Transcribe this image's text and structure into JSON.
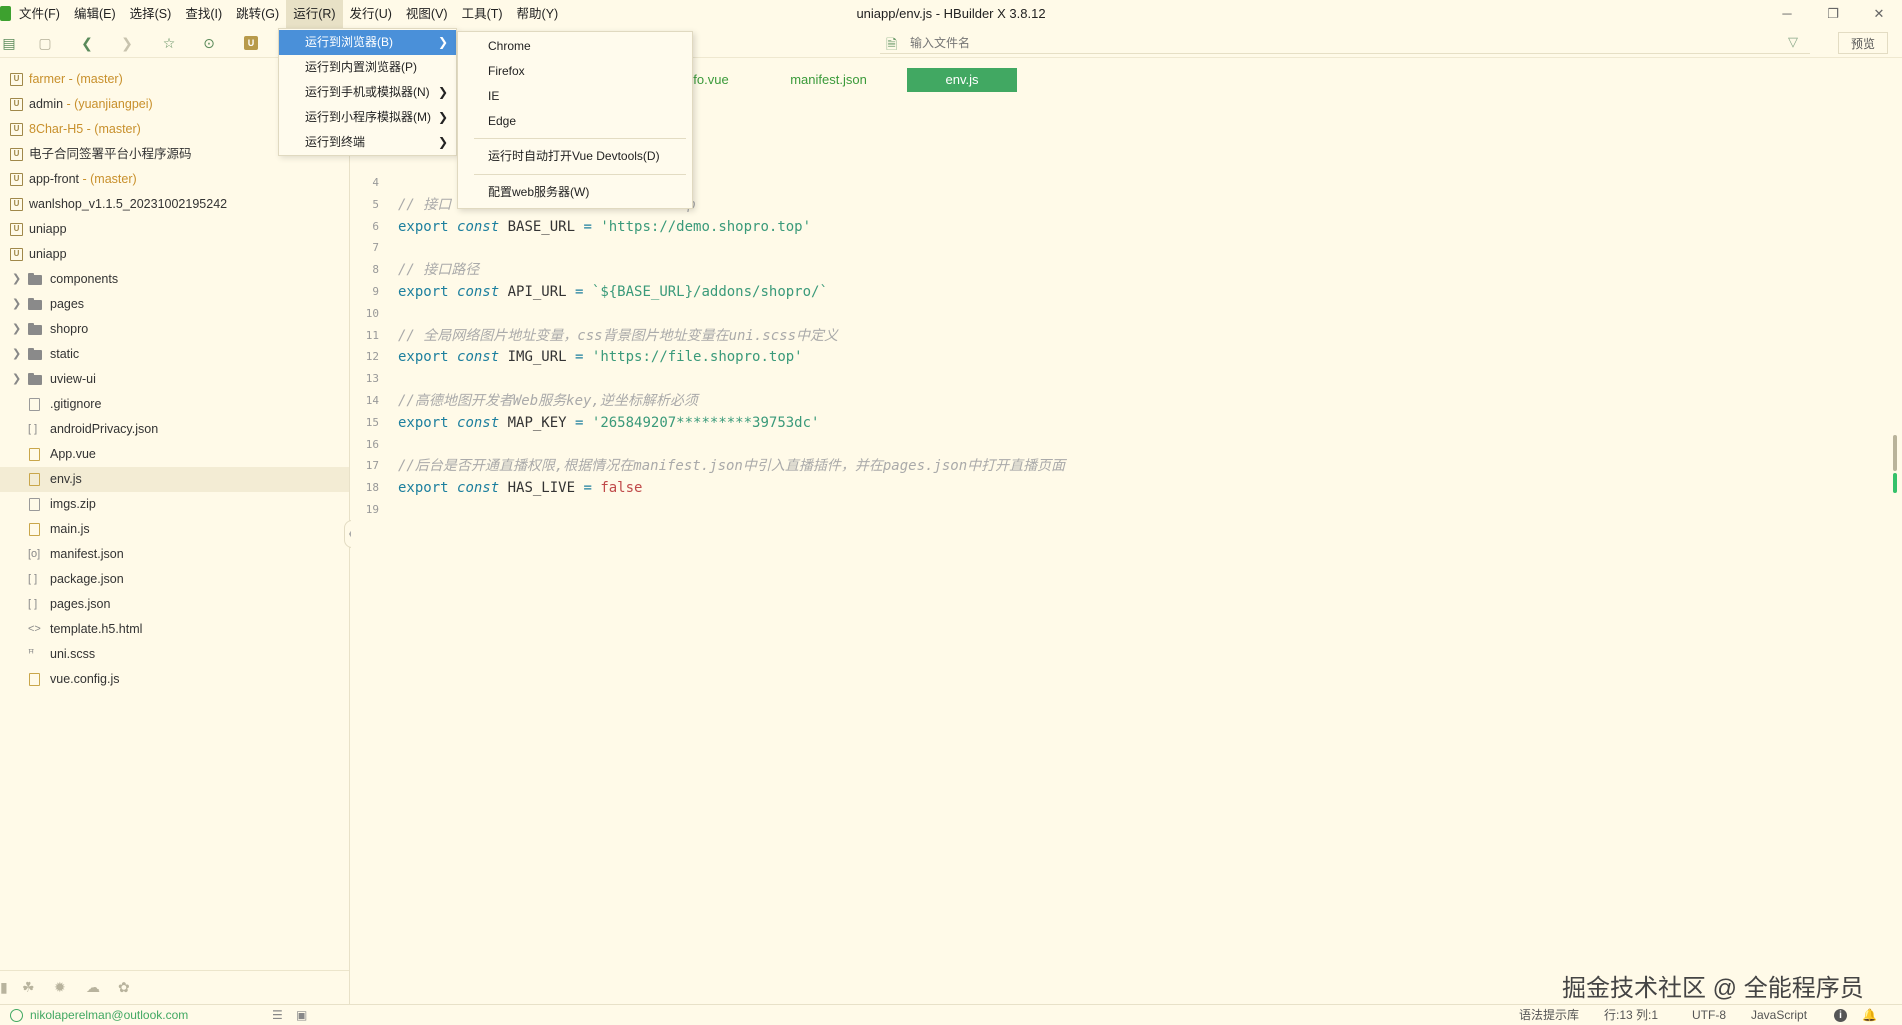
{
  "window": {
    "title": "uniapp/env.js - HBuilder X 3.8.12",
    "minimize": "─",
    "restore": "❐",
    "close": "✕"
  },
  "menubar": [
    {
      "label": "文件(F)"
    },
    {
      "label": "编辑(E)"
    },
    {
      "label": "选择(S)"
    },
    {
      "label": "查找(I)"
    },
    {
      "label": "跳转(G)"
    },
    {
      "label": "运行(R)"
    },
    {
      "label": "发行(U)"
    },
    {
      "label": "视图(V)"
    },
    {
      "label": "工具(T)"
    },
    {
      "label": "帮助(Y)"
    }
  ],
  "toolbar": {
    "project_chip": "U",
    "filter_placeholder": "输入文件名",
    "preview_label": "预览"
  },
  "sidebar": {
    "projects": [
      {
        "name": "farmer",
        "branch": " - (master)"
      },
      {
        "name": "admin",
        "branch": " - (yuanjiangpei)"
      },
      {
        "name": "8Char-H5",
        "branch": " - (master)"
      },
      {
        "name": "电子合同签署平台小程序源码",
        "branch": ""
      },
      {
        "name": "app-front",
        "branch": " - (master)"
      },
      {
        "name": "wanlshop_v1.1.5_20231002195242",
        "branch": ""
      },
      {
        "name": "uniapp",
        "branch": ""
      },
      {
        "name": "uniapp",
        "branch": ""
      }
    ],
    "folders": [
      {
        "label": "components"
      },
      {
        "label": "pages"
      },
      {
        "label": "shopro"
      },
      {
        "label": "static"
      },
      {
        "label": "uview-ui"
      }
    ],
    "files": [
      {
        "label": ".gitignore"
      },
      {
        "label": "androidPrivacy.json"
      },
      {
        "label": "App.vue"
      },
      {
        "label": "env.js"
      },
      {
        "label": "imgs.zip"
      },
      {
        "label": "main.js"
      },
      {
        "label": "manifest.json"
      },
      {
        "label": "package.json"
      },
      {
        "label": "pages.json"
      },
      {
        "label": "template.h5.html"
      },
      {
        "label": "uni.scss"
      },
      {
        "label": "vue.config.js"
      }
    ]
  },
  "editor": {
    "tabs": [
      {
        "label": "fo.vue"
      },
      {
        "label": "manifest.json"
      },
      {
        "label": "env.js"
      }
    ],
    "lines": [
      {
        "n": "4",
        "parts": []
      },
      {
        "n": "5",
        "parts": [
          {
            "c": "cmt",
            "t": "// 接口"
          },
          {
            "c": "cmt",
            "t": "                          top"
          }
        ]
      },
      {
        "n": "6",
        "parts": [
          {
            "c": "kw",
            "t": "export "
          },
          {
            "c": "kw-i",
            "t": "const "
          },
          {
            "c": "ident",
            "t": "BASE_URL "
          },
          {
            "c": "op",
            "t": "= "
          },
          {
            "c": "str",
            "t": "'https://demo.shopro.top'"
          }
        ]
      },
      {
        "n": "7",
        "parts": []
      },
      {
        "n": "8",
        "parts": [
          {
            "c": "cmt",
            "t": "// 接口路径"
          }
        ]
      },
      {
        "n": "9",
        "parts": [
          {
            "c": "kw",
            "t": "export "
          },
          {
            "c": "kw-i",
            "t": "const "
          },
          {
            "c": "ident",
            "t": "API_URL "
          },
          {
            "c": "op",
            "t": "= "
          },
          {
            "c": "str",
            "t": "`${BASE_URL}/addons/shopro/`"
          }
        ]
      },
      {
        "n": "10",
        "parts": []
      },
      {
        "n": "11",
        "parts": [
          {
            "c": "cmt",
            "t": "// 全局网络图片地址变量，css背景图片地址变量在uni.scss中定义"
          }
        ]
      },
      {
        "n": "12",
        "parts": [
          {
            "c": "kw",
            "t": "export "
          },
          {
            "c": "kw-i",
            "t": "const "
          },
          {
            "c": "ident",
            "t": "IMG_URL "
          },
          {
            "c": "op",
            "t": "= "
          },
          {
            "c": "str",
            "t": "'https://file.shopro.top'"
          }
        ]
      },
      {
        "n": "13",
        "parts": []
      },
      {
        "n": "14",
        "parts": [
          {
            "c": "cmt",
            "t": "//高德地图开发者Web服务key,逆坐标解析必须"
          }
        ]
      },
      {
        "n": "15",
        "parts": [
          {
            "c": "kw",
            "t": "export "
          },
          {
            "c": "kw-i",
            "t": "const "
          },
          {
            "c": "ident",
            "t": "MAP_KEY "
          },
          {
            "c": "op",
            "t": "= "
          },
          {
            "c": "str",
            "t": "'265849207*********39753dc'"
          }
        ]
      },
      {
        "n": "16",
        "parts": []
      },
      {
        "n": "17",
        "parts": [
          {
            "c": "cmt",
            "t": "//后台是否开通直播权限,根据情况在manifest.json中引入直播插件，并在pages.json中打开直播页面"
          }
        ]
      },
      {
        "n": "18",
        "parts": [
          {
            "c": "kw",
            "t": "export "
          },
          {
            "c": "kw-i",
            "t": "const "
          },
          {
            "c": "ident",
            "t": "HAS_LIVE "
          },
          {
            "c": "op",
            "t": "= "
          },
          {
            "c": "bool",
            "t": "false"
          }
        ]
      },
      {
        "n": "19",
        "parts": []
      }
    ]
  },
  "run_menu": [
    {
      "label": "运行到浏览器(B)",
      "arrow": "❯"
    },
    {
      "label": "运行到内置浏览器(P)",
      "arrow": ""
    },
    {
      "label": "运行到手机或模拟器(N)",
      "arrow": "❯"
    },
    {
      "label": "运行到小程序模拟器(M)",
      "arrow": "❯"
    },
    {
      "label": "运行到终端",
      "arrow": "❯"
    }
  ],
  "browser_submenu": {
    "browsers": [
      {
        "label": "Chrome"
      },
      {
        "label": "Firefox"
      },
      {
        "label": "IE"
      },
      {
        "label": "Edge"
      }
    ],
    "devtools": "运行时自动打开Vue Devtools(D)",
    "web_server": "配置web服务器(W)"
  },
  "watermark": "掘金技术社区 @ 全能程序员",
  "statusbar": {
    "email": "nikolaperelman@outlook.com",
    "grammar": "语法提示库",
    "position": "行:13  列:1",
    "encoding": "UTF-8",
    "language": "JavaScript",
    "info": "i",
    "bell": "🔔"
  },
  "colors": {
    "background": "#fffae8",
    "accent_green": "#41a862",
    "menu_highlight": "#4a90d9"
  }
}
